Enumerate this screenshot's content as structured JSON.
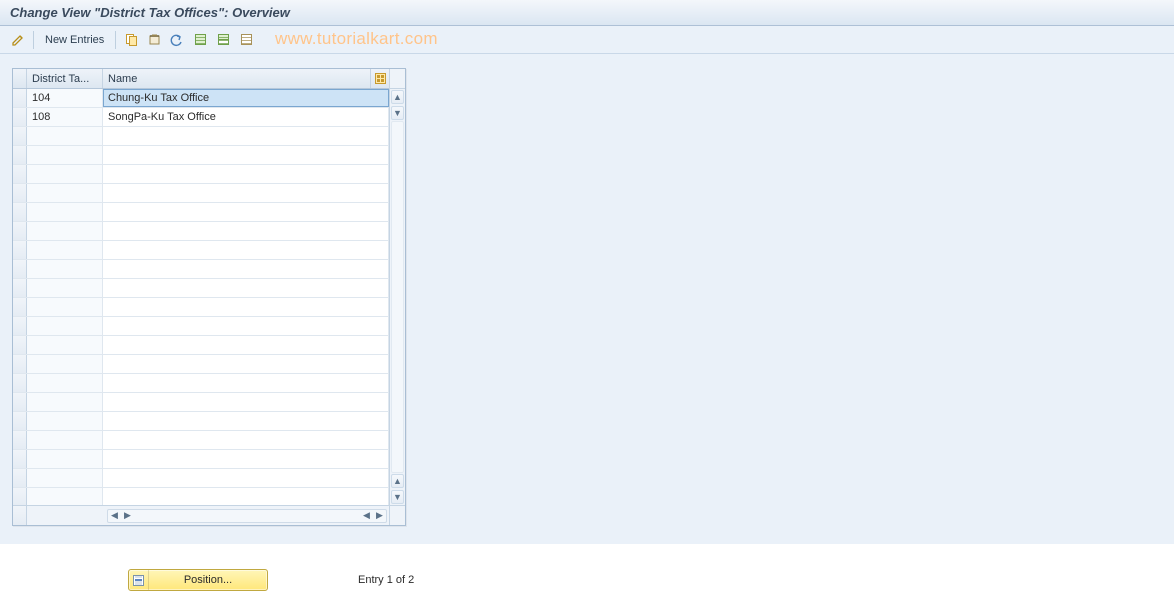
{
  "title": "Change View \"District Tax Offices\": Overview",
  "toolbar": {
    "new_entries_label": "New Entries"
  },
  "watermark": "www.tutorialkart.com",
  "grid": {
    "columns": {
      "col1_header": "District Ta...",
      "col2_header": "Name"
    },
    "rows": [
      {
        "code": "104",
        "name": "Chung-Ku Tax Office",
        "selected": true
      },
      {
        "code": "108",
        "name": "SongPa-Ku Tax Office",
        "selected": false
      }
    ],
    "blank_row_count": 20
  },
  "footer": {
    "position_label": "Position...",
    "entry_status": "Entry 1 of 2"
  }
}
